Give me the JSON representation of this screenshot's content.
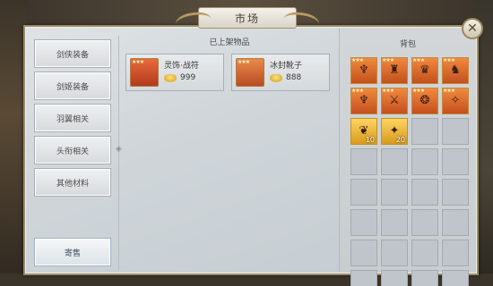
{
  "window": {
    "title": "市场"
  },
  "sidebar": {
    "categories": [
      {
        "label": "剑侠装备"
      },
      {
        "label": "剑姬装备"
      },
      {
        "label": "羽翼相关"
      },
      {
        "label": "头衔相关"
      },
      {
        "label": "其他材料"
      }
    ],
    "consign_label": "寄售"
  },
  "listed": {
    "title": "已上架物品",
    "items": [
      {
        "name": "灵饰·战符",
        "price": "999",
        "stars": "★★★",
        "icon": "talisman-icon"
      },
      {
        "name": "冰封靴子",
        "price": "888",
        "stars": "★★★",
        "icon": "boots-icon"
      }
    ]
  },
  "bag": {
    "title": "背包",
    "slots": [
      {
        "stars": "★★★",
        "glyph": "♆",
        "icon": "armor-icon",
        "count": ""
      },
      {
        "stars": "★★★",
        "glyph": "♜",
        "icon": "bracer-icon",
        "count": ""
      },
      {
        "stars": "★★★",
        "glyph": "♛",
        "icon": "helmet-icon",
        "count": ""
      },
      {
        "stars": "★★★",
        "glyph": "♞",
        "icon": "mount-armor-icon",
        "count": ""
      },
      {
        "stars": "★★★",
        "glyph": "♆",
        "icon": "robe-icon",
        "count": ""
      },
      {
        "stars": "★★★",
        "glyph": "⚔",
        "icon": "sword-icon",
        "count": ""
      },
      {
        "stars": "★★★",
        "glyph": "❂",
        "icon": "amulet-icon",
        "count": ""
      },
      {
        "stars": "★★★",
        "glyph": "✧",
        "icon": "dagger-icon",
        "count": ""
      },
      {
        "stars": "",
        "glyph": "❦",
        "icon": "feather-icon",
        "count": "10"
      },
      {
        "stars": "",
        "glyph": "✦",
        "icon": "scroll-icon",
        "count": "20"
      }
    ],
    "empty_slots": 22
  },
  "colors": {
    "accent": "#b89a62",
    "item_bg": "#e96a3a",
    "material_bg": "#ffd462"
  }
}
